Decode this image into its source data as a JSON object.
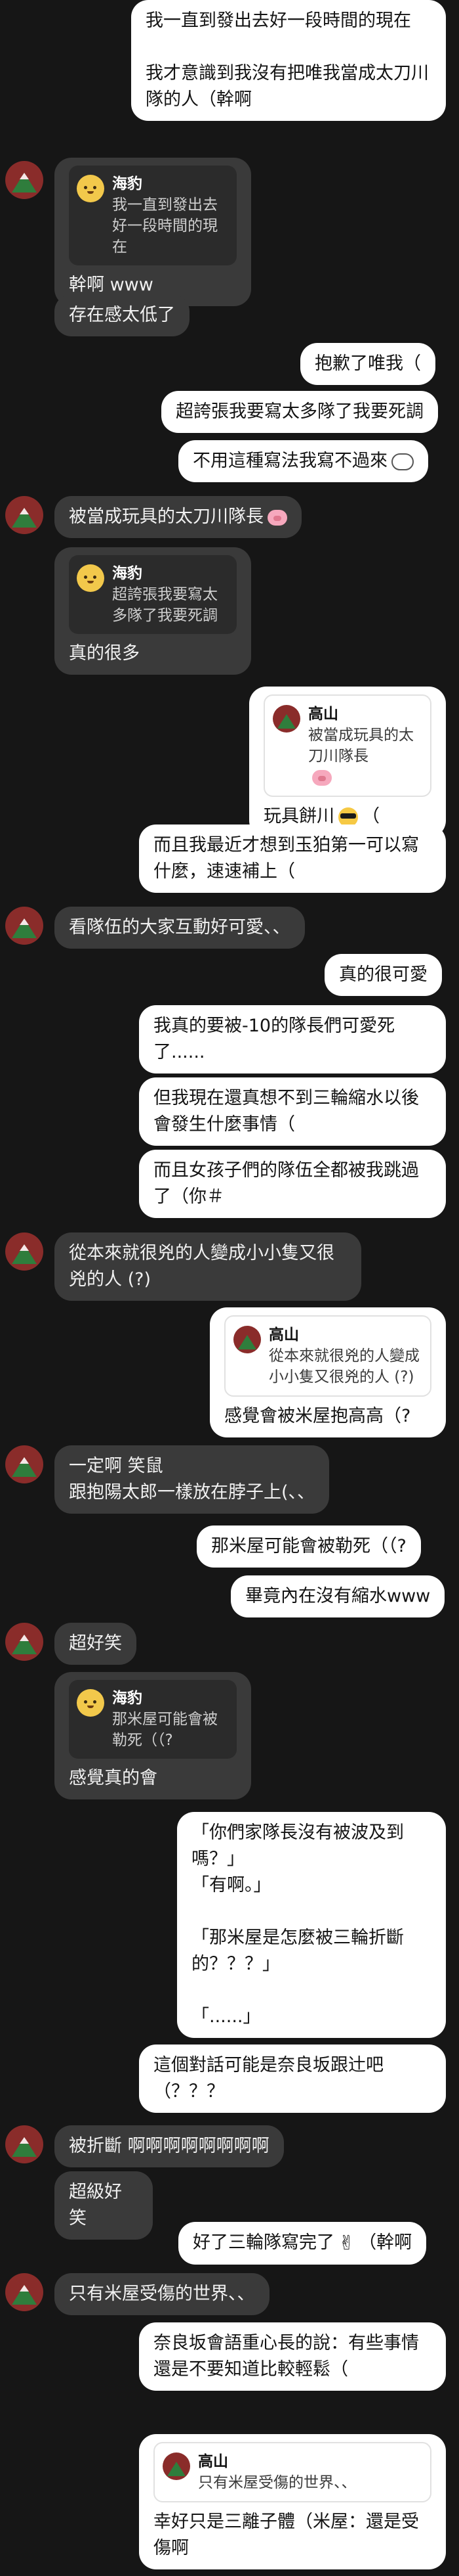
{
  "messages": [
    {
      "dir": "out",
      "text": "我一直到發出去好一段時間的現在\n\n我才意識到我沒有把唯我當成太刀川隊的人（幹啊"
    },
    {
      "dir": "in",
      "quote": {
        "name": "海豹",
        "text": "我一直到發出去好一段時間的現在",
        "avatar": "seal-avatar"
      },
      "text": "幹啊 www"
    },
    {
      "dir": "in",
      "text": "存在感太低了"
    },
    {
      "dir": "out",
      "text": "抱歉了唯我（"
    },
    {
      "dir": "out",
      "text": "超誇張我要寫太多隊了我要死調"
    },
    {
      "dir": "out",
      "text": "不用這種寫法我寫不過來",
      "emoji": "cloud-face-icon"
    },
    {
      "dir": "in",
      "text": "被當成玩具的太刀川隊長",
      "emoji": "pig-face-icon"
    },
    {
      "dir": "in",
      "quote": {
        "name": "海豹",
        "text": "超誇張我要寫太多隊了我要死調",
        "avatar": "seal-avatar"
      },
      "text": "真的很多"
    },
    {
      "dir": "out",
      "quote": {
        "name": "高山",
        "text": "被當成玩具的太刀川隊長",
        "emoji": "pig-face-icon",
        "avatar": "mountain-avatar"
      },
      "text": "玩具餅川",
      "emoji": "sunglasses-face-icon",
      "text2": "（"
    },
    {
      "dir": "out",
      "text": "而且我最近才想到玉狛第一可以寫什麼，速速補上（"
    },
    {
      "dir": "in",
      "text": "看隊伍的大家互動好可愛、、"
    },
    {
      "dir": "out",
      "text": "真的很可愛"
    },
    {
      "dir": "out",
      "text": "我真的要被-10的隊長們可愛死了......"
    },
    {
      "dir": "out",
      "text": "但我現在還真想不到三輪縮水以後會發生什麼事情（"
    },
    {
      "dir": "out",
      "text": "而且女孩子們的隊伍全都被我跳過了（你＃"
    },
    {
      "dir": "in",
      "text": "從本來就很兇的人變成小小隻又很兇的人 (?)"
    },
    {
      "dir": "out",
      "quote": {
        "name": "高山",
        "text": "從本來就很兇的人變成小小隻又很兇的人 (?)",
        "avatar": "mountain-avatar"
      },
      "text": "感覺會被米屋抱高高（?"
    },
    {
      "dir": "in",
      "text": "一定啊 笑鼠\n跟抱陽太郎一樣放在脖子上(、、"
    },
    {
      "dir": "out",
      "text": "那米屋可能會被勒死（（?"
    },
    {
      "dir": "out",
      "text": "畢竟內在沒有縮水www"
    },
    {
      "dir": "in",
      "text": "超好笑"
    },
    {
      "dir": "in",
      "quote": {
        "name": "海豹",
        "text": "那米屋可能會被勒死（（?",
        "avatar": "seal-avatar"
      },
      "text": "感覺真的會"
    },
    {
      "dir": "out",
      "text": "「你們家隊長沒有被波及到嗎？」\n「有啊。」\n\n「那米屋是怎麼被三輪折斷的？？？」\n\n「......」"
    },
    {
      "dir": "out",
      "text": "這個對話可能是奈良坂跟辻吧（？？？"
    },
    {
      "dir": "in",
      "text": "被折斷 啊啊啊啊啊啊啊啊"
    },
    {
      "dir": "in",
      "text": "超級好笑"
    },
    {
      "dir": "out",
      "text": "好了三輪隊寫完了",
      "emoji": "victory-hand-icon",
      "text2": "（幹啊"
    },
    {
      "dir": "in",
      "text": "只有米屋受傷的世界、、"
    },
    {
      "dir": "out",
      "text": "奈良坂會語重心長的說：有些事情還是不要知道比較輕鬆（"
    },
    {
      "dir": "out",
      "quote": {
        "name": "高山",
        "text": "只有米屋受傷的世界、、",
        "avatar": "mountain-avatar"
      },
      "text": "幸好只是三離子體（米屋：還是受傷啊"
    }
  ],
  "colors": {
    "background": "#161616",
    "outgoing": "#ffffff",
    "incoming": "#3a3a3a"
  }
}
